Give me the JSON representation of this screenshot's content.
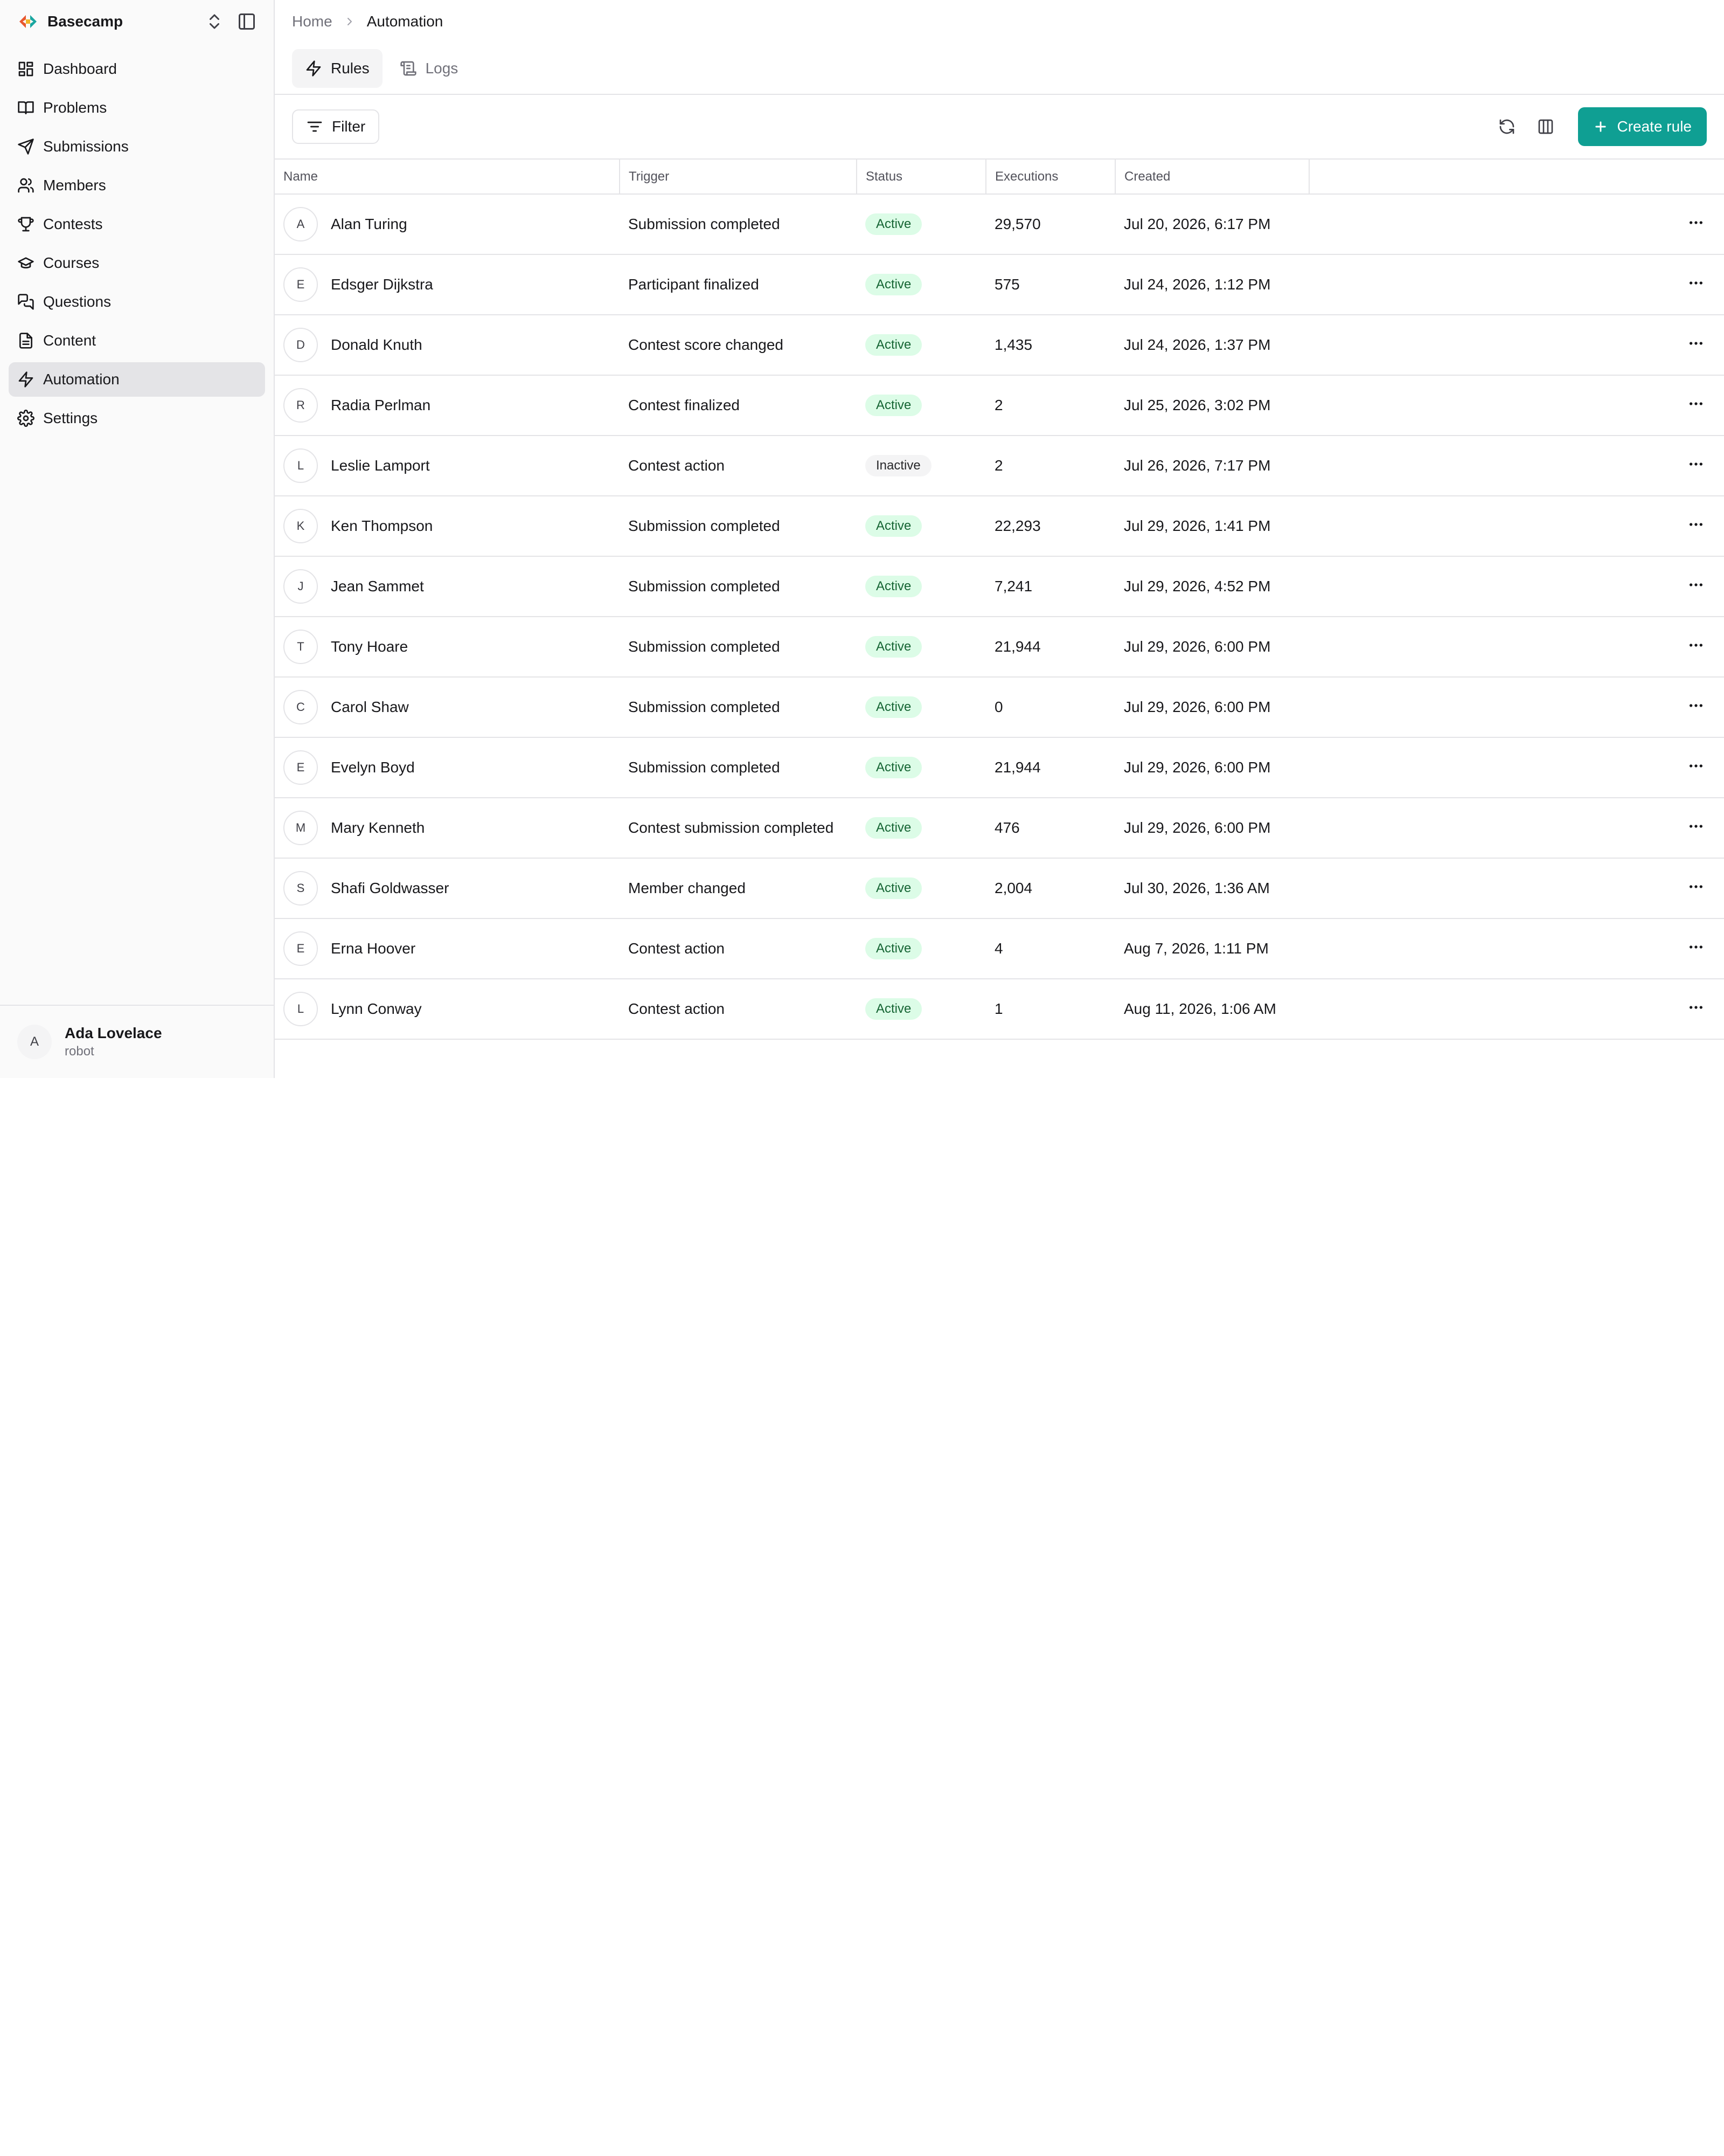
{
  "brand": {
    "name": "Basecamp"
  },
  "colors": {
    "accent": "#0f9f93",
    "active_badge_bg": "#dcfce7",
    "active_badge_fg": "#166534"
  },
  "sidebar": {
    "items": [
      {
        "label": "Dashboard",
        "icon": "dashboard-icon"
      },
      {
        "label": "Problems",
        "icon": "book-icon"
      },
      {
        "label": "Submissions",
        "icon": "send-icon"
      },
      {
        "label": "Members",
        "icon": "users-icon"
      },
      {
        "label": "Contests",
        "icon": "trophy-icon"
      },
      {
        "label": "Courses",
        "icon": "graduation-cap-icon"
      },
      {
        "label": "Questions",
        "icon": "messages-icon"
      },
      {
        "label": "Content",
        "icon": "file-text-icon"
      },
      {
        "label": "Automation",
        "icon": "zap-icon",
        "active": true
      },
      {
        "label": "Settings",
        "icon": "gear-icon"
      }
    ]
  },
  "user": {
    "initial": "A",
    "name": "Ada Lovelace",
    "role": "robot"
  },
  "breadcrumb": {
    "home": "Home",
    "current": "Automation"
  },
  "tabs": [
    {
      "label": "Rules",
      "active": true
    },
    {
      "label": "Logs",
      "active": false
    }
  ],
  "toolbar": {
    "filter_label": "Filter",
    "create_label": "Create rule"
  },
  "table": {
    "columns": [
      "Name",
      "Trigger",
      "Status",
      "Executions",
      "Created"
    ],
    "rows": [
      {
        "initial": "A",
        "name": "Alan Turing",
        "trigger": "Submission completed",
        "status": "Active",
        "executions": "29,570",
        "created": "Jul 20, 2026, 6:17 PM"
      },
      {
        "initial": "E",
        "name": "Edsger Dijkstra",
        "trigger": "Participant finalized",
        "status": "Active",
        "executions": "575",
        "created": "Jul 24, 2026, 1:12 PM"
      },
      {
        "initial": "D",
        "name": "Donald Knuth",
        "trigger": "Contest score changed",
        "status": "Active",
        "executions": "1,435",
        "created": "Jul 24, 2026, 1:37 PM"
      },
      {
        "initial": "R",
        "name": "Radia Perlman",
        "trigger": "Contest finalized",
        "status": "Active",
        "executions": "2",
        "created": "Jul 25, 2026, 3:02 PM"
      },
      {
        "initial": "L",
        "name": "Leslie Lamport",
        "trigger": "Contest action",
        "status": "Inactive",
        "executions": "2",
        "created": "Jul 26, 2026, 7:17 PM"
      },
      {
        "initial": "K",
        "name": "Ken Thompson",
        "trigger": "Submission completed",
        "status": "Active",
        "executions": "22,293",
        "created": "Jul 29, 2026, 1:41 PM"
      },
      {
        "initial": "J",
        "name": "Jean Sammet",
        "trigger": "Submission completed",
        "status": "Active",
        "executions": "7,241",
        "created": "Jul 29, 2026, 4:52 PM"
      },
      {
        "initial": "T",
        "name": "Tony Hoare",
        "trigger": "Submission completed",
        "status": "Active",
        "executions": "21,944",
        "created": "Jul 29, 2026, 6:00 PM"
      },
      {
        "initial": "C",
        "name": "Carol Shaw",
        "trigger": "Submission completed",
        "status": "Active",
        "executions": "0",
        "created": "Jul 29, 2026, 6:00 PM"
      },
      {
        "initial": "E",
        "name": "Evelyn Boyd",
        "trigger": "Submission completed",
        "status": "Active",
        "executions": "21,944",
        "created": "Jul 29, 2026, 6:00 PM"
      },
      {
        "initial": "M",
        "name": "Mary Kenneth",
        "trigger": "Contest submission completed",
        "status": "Active",
        "executions": "476",
        "created": "Jul 29, 2026, 6:00 PM"
      },
      {
        "initial": "S",
        "name": "Shafi Goldwasser",
        "trigger": "Member changed",
        "status": "Active",
        "executions": "2,004",
        "created": "Jul 30, 2026, 1:36 AM"
      },
      {
        "initial": "E",
        "name": "Erna Hoover",
        "trigger": "Contest action",
        "status": "Active",
        "executions": "4",
        "created": "Aug 7, 2026, 1:11 PM"
      },
      {
        "initial": "L",
        "name": "Lynn Conway",
        "trigger": "Contest action",
        "status": "Active",
        "executions": "1",
        "created": "Aug 11, 2026, 1:06 AM"
      }
    ]
  }
}
